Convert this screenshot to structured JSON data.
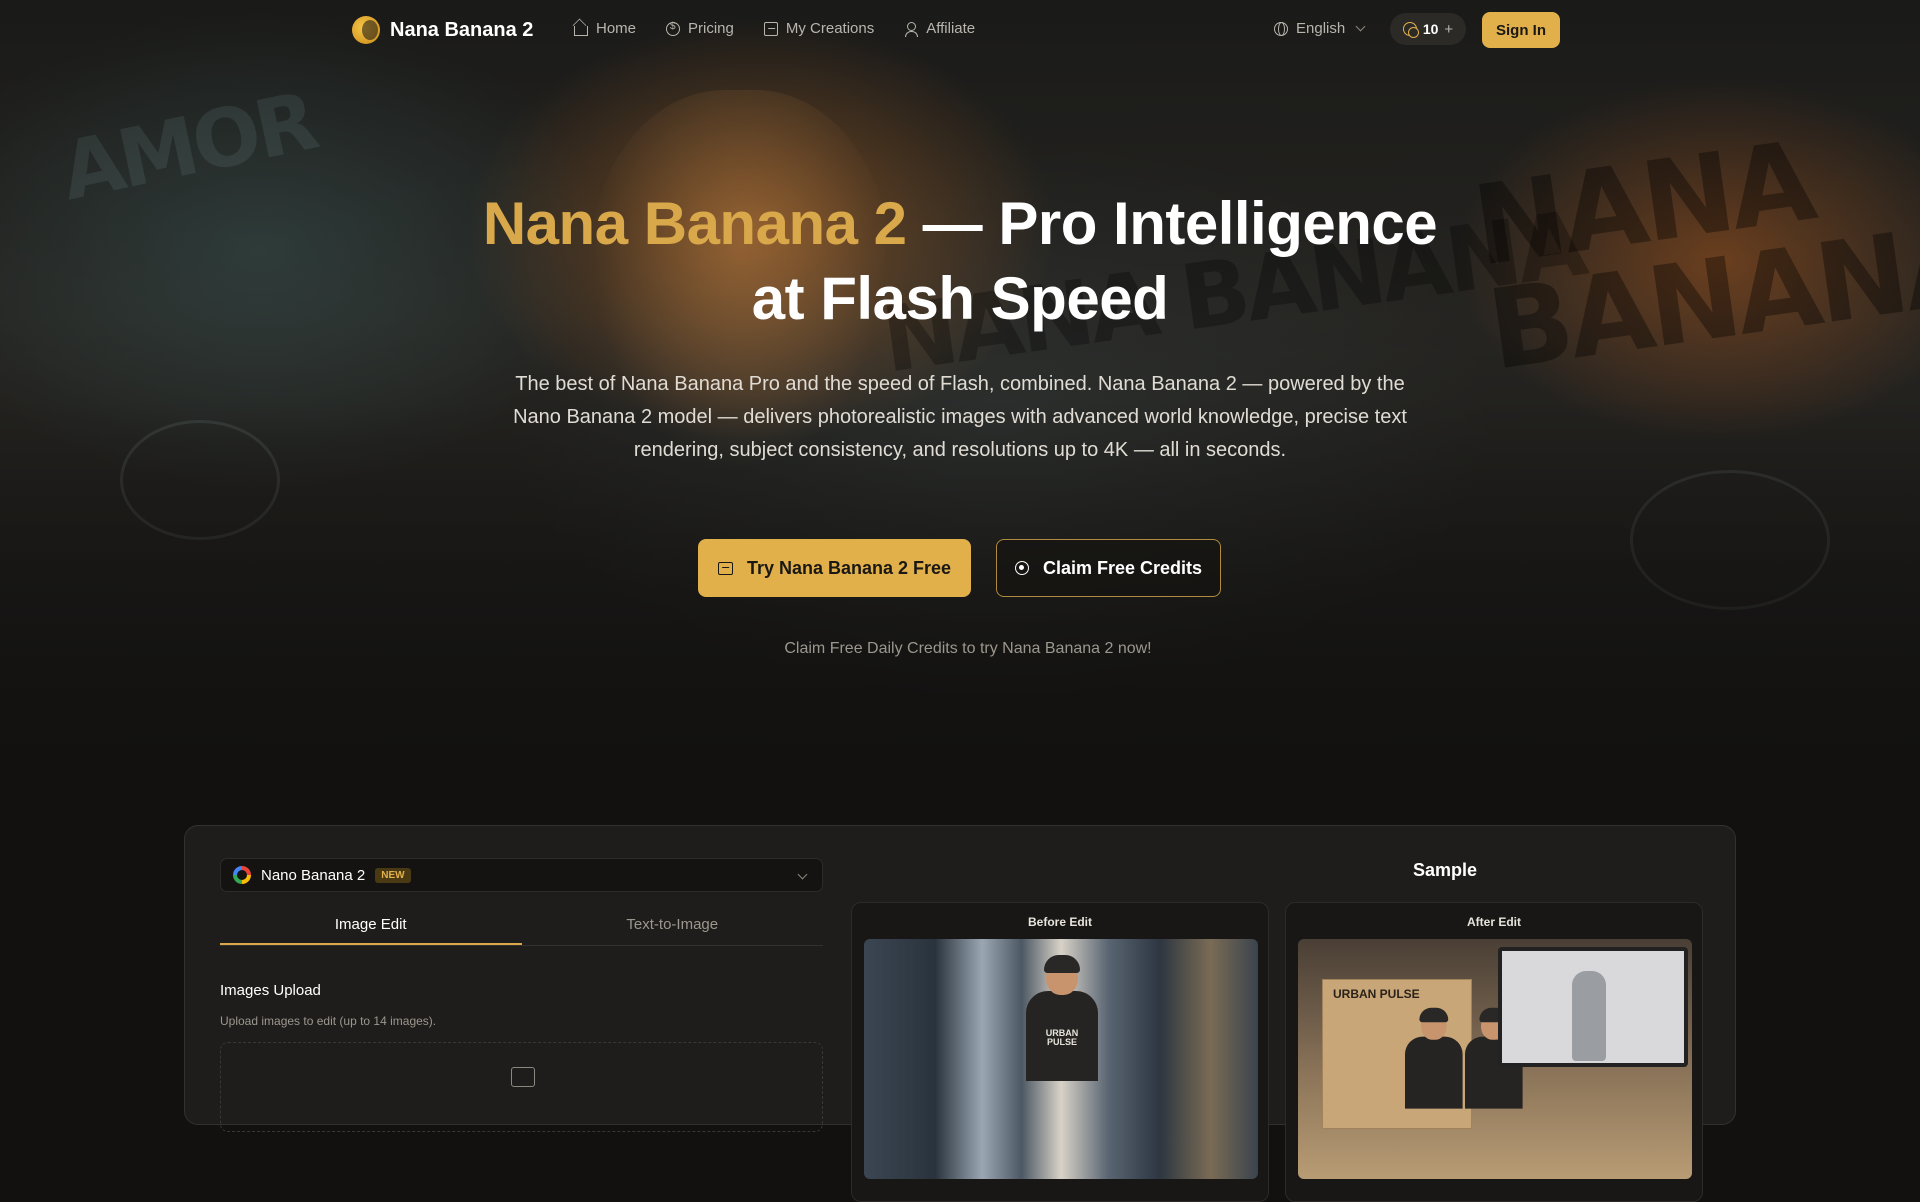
{
  "nav": {
    "brand": "Nana Banana 2",
    "links": [
      {
        "label": "Home",
        "icon": "home-icon"
      },
      {
        "label": "Pricing",
        "icon": "dollar-circle-icon"
      },
      {
        "label": "My Creations",
        "icon": "image-icon"
      },
      {
        "label": "Affiliate",
        "icon": "user-icon"
      }
    ],
    "language": "English",
    "credits": "10",
    "credits_plus": "+",
    "sign_in": "Sign In"
  },
  "hero": {
    "title_accent": "Nana Banana 2",
    "title_rest_line1": " — Pro Intelligence",
    "title_line2": "at Flash Speed",
    "subtitle": "The best of Nana Banana Pro and the speed of Flash, combined. Nana Banana 2 — powered by the Nano Banana 2 model — delivers photorealistic images with advanced world knowledge, precise text rendering, subject consistency, and resolutions up to 4K — all in seconds.",
    "primary_cta": "Try Nana Banana 2 Free",
    "secondary_cta": "Claim Free Credits",
    "note": "Claim Free Daily Credits to try Nana Banana 2 now!",
    "graffiti": [
      "NANA BANANA",
      "NANA BANANA",
      "AMOR"
    ]
  },
  "generator": {
    "model": {
      "name": "Nano Banana 2",
      "badge": "NEW"
    },
    "tabs": [
      {
        "label": "Image Edit",
        "active": true
      },
      {
        "label": "Text-to-Image",
        "active": false
      }
    ],
    "upload": {
      "title": "Images Upload",
      "hint": "Upload images to edit (up to 14 images)."
    }
  },
  "sample": {
    "title": "Sample",
    "before_label": "Before Edit",
    "after_label": "After Edit",
    "hoodie_text": "URBAN PULSE",
    "box_text": "URBAN PULSE"
  },
  "colors": {
    "accent": "#e2b04a",
    "accent_text": "#d9a84a",
    "background": "#121110",
    "panel": "#1f1d1b"
  }
}
